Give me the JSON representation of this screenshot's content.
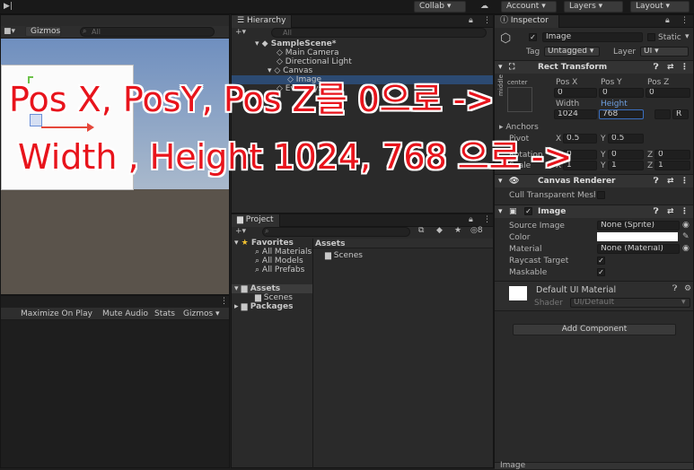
{
  "toolbar": {
    "play_icon": "step-icon",
    "collab": "Collab",
    "account": "Account",
    "layers": "Layers",
    "layout": "Layout"
  },
  "scene": {
    "gizmos": "Gizmos",
    "search_placeholder": "All"
  },
  "game": {
    "maximize": "Maximize On Play",
    "mute": "Mute Audio",
    "stats": "Stats",
    "gizmos": "Gizmos"
  },
  "hierarchy": {
    "tab": "Hierarchy",
    "search_placeholder": "All",
    "items": [
      {
        "label": "SampleScene*"
      },
      {
        "label": "Main Camera"
      },
      {
        "label": "Directional Light"
      },
      {
        "label": "Canvas"
      },
      {
        "label": "Image"
      },
      {
        "label": "EventSystem"
      }
    ]
  },
  "project": {
    "tab": "Project",
    "favorites": "Favorites",
    "fav_items": [
      "All Materials",
      "All Models",
      "All Prefabs"
    ],
    "assets": "Assets",
    "scenes": "Scenes",
    "packages": "Packages",
    "right_header": "Assets",
    "right_folder": "Scenes",
    "count": "8"
  },
  "inspector": {
    "tab": "Inspector",
    "object_name": "Image",
    "static_label": "Static",
    "tag_label": "Tag",
    "tag_value": "Untagged",
    "layer_label": "Layer",
    "layer_value": "UI",
    "rect_transform": {
      "title": "Rect Transform",
      "anchor_label": "center",
      "side_label": "middle",
      "pos_x_label": "Pos X",
      "pos_y_label": "Pos Y",
      "pos_z_label": "Pos Z",
      "pos_x": "0",
      "pos_y": "0",
      "pos_z": "0",
      "width_label": "Width",
      "height_label": "Height",
      "width": "1024",
      "height": "768",
      "anchors_label": "Anchors",
      "pivot_label": "Pivot",
      "pivot_x": "0.5",
      "pivot_y": "0.5",
      "rotation_label": "Rotation",
      "scale_label": "Scale",
      "x_label": "X",
      "y_label": "Y",
      "z_label": "Z",
      "rot_x": "0",
      "rot_y": "0",
      "rot_z": "0",
      "scale_x": "1",
      "scale_y": "1",
      "scale_z": "1",
      "r_button": "R"
    },
    "canvas_renderer": {
      "title": "Canvas Renderer",
      "cull_label": "Cull Transparent Mesh"
    },
    "image": {
      "title": "Image",
      "source_label": "Source Image",
      "source_value": "None (Sprite)",
      "color_label": "Color",
      "material_label": "Material",
      "material_value": "None (Material)",
      "raycast_label": "Raycast Target",
      "maskable_label": "Maskable"
    },
    "material": {
      "name": "Default UI Material",
      "shader_label": "Shader",
      "shader_value": "UI/Default"
    },
    "add_component": "Add Component",
    "bottom_label": "Image"
  },
  "overlay": {
    "line1": "Pos X, PosY, Pos Z를 0으로 ->",
    "line2": "Width , Height 1024, 768 으로 ->"
  },
  "colors": {
    "annotation": "#e8141c",
    "scene_sky": "#7f9fc7",
    "scene_ground": "#5a534b",
    "selected_field": "#3a5f92"
  }
}
